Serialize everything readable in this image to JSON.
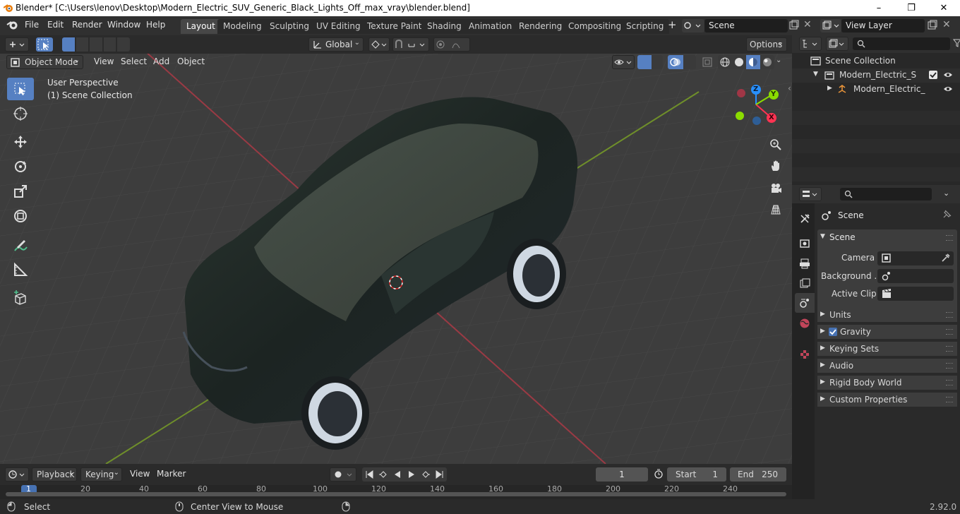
{
  "window": {
    "title": "Blender* [C:\\Users\\lenov\\Desktop\\Modern_Electric_SUV_Generic_Black_Lights_Off_max_vray\\blender.blend]",
    "minimize": "–",
    "maximize": "❐",
    "close": "✕"
  },
  "menubar": {
    "items": [
      "File",
      "Edit",
      "Render",
      "Window",
      "Help"
    ],
    "workspaces": [
      "Layout",
      "Modeling",
      "Sculpting",
      "UV Editing",
      "Texture Paint",
      "Shading",
      "Animation",
      "Rendering",
      "Compositing",
      "Scripting"
    ],
    "active_workspace": "Layout",
    "add_workspace": "+",
    "scene_name": "Scene",
    "view_layer": "View Layer"
  },
  "viewport": {
    "transform_orientation": "Global",
    "options": "Options",
    "mode": "Object Mode",
    "menus": [
      "View",
      "Select",
      "Add",
      "Object"
    ],
    "perspective_label": "User Perspective",
    "collection_label": "(1) Scene Collection",
    "gizmo": {
      "x": "X",
      "y": "Y",
      "z": "Z"
    }
  },
  "timeline": {
    "menus": [
      "Playback",
      "Keying",
      "View",
      "Marker"
    ],
    "current_frame": "1",
    "start_label": "Start",
    "start_value": "1",
    "end_label": "End",
    "end_value": "250",
    "ruler": [
      "1",
      "20",
      "40",
      "60",
      "80",
      "100",
      "120",
      "140",
      "160",
      "180",
      "200",
      "220",
      "240"
    ]
  },
  "outliner": {
    "root": "Scene Collection",
    "collection": "Modern_Electric_SUV_Ge",
    "object": "Modern_Electric_SUV"
  },
  "properties": {
    "context": "Scene",
    "panel_title": "Scene",
    "fields": [
      {
        "label": "Camera"
      },
      {
        "label": "Background ..."
      },
      {
        "label": "Active Clip"
      }
    ],
    "subpanels": [
      "Units",
      "Gravity",
      "Keying Sets",
      "Audio",
      "Rigid Body World",
      "Custom Properties"
    ],
    "gravity_checked": true
  },
  "statusbar": {
    "left_action": "Select",
    "mid_action": "Center View to Mouse",
    "version": "2.92.0"
  },
  "colors": {
    "accent": "#5680c2",
    "active_ws": "#474747",
    "axis_x": "#ff3352",
    "axis_y": "#8bdc00",
    "axis_z": "#2890ff"
  }
}
